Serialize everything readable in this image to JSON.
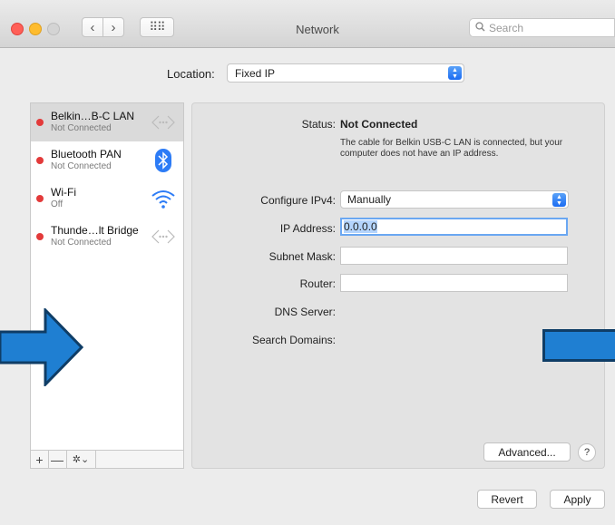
{
  "window": {
    "title": "Network"
  },
  "toolbar": {
    "back_icon": "‹",
    "forward_icon": "›",
    "grid_icon": "⠿⠿",
    "search_placeholder": "Search"
  },
  "location": {
    "label": "Location:",
    "value": "Fixed IP"
  },
  "services": [
    {
      "name": "Belkin…B-C LAN",
      "status": "Not Connected",
      "icon": "ethernet-icon"
    },
    {
      "name": "Bluetooth PAN",
      "status": "Not Connected",
      "icon": "bluetooth-icon"
    },
    {
      "name": "Wi-Fi",
      "status": "Off",
      "icon": "wifi-icon"
    },
    {
      "name": "Thunde…lt Bridge",
      "status": "Not Connected",
      "icon": "ethernet-icon"
    }
  ],
  "sidebar_footer": {
    "add": "+",
    "remove": "—",
    "action": "✲⌄"
  },
  "details": {
    "status_label": "Status:",
    "status_value": "Not Connected",
    "status_description": "The cable for Belkin USB-C LAN is connected, but your computer does not have an IP address.",
    "configure_label": "Configure IPv4:",
    "configure_value": "Manually",
    "ip_label": "IP Address:",
    "ip_value": "0.0.0.0",
    "subnet_label": "Subnet Mask:",
    "subnet_value": "",
    "router_label": "Router:",
    "router_value": "",
    "dns_label": "DNS Server:",
    "search_domains_label": "Search Domains:"
  },
  "buttons": {
    "advanced": "Advanced...",
    "help": "?",
    "revert": "Revert",
    "apply": "Apply"
  },
  "colors": {
    "status_dot": "#e33a3a",
    "accent": "#1c6cf2",
    "overlay_arrow": "#1f7fd2"
  }
}
